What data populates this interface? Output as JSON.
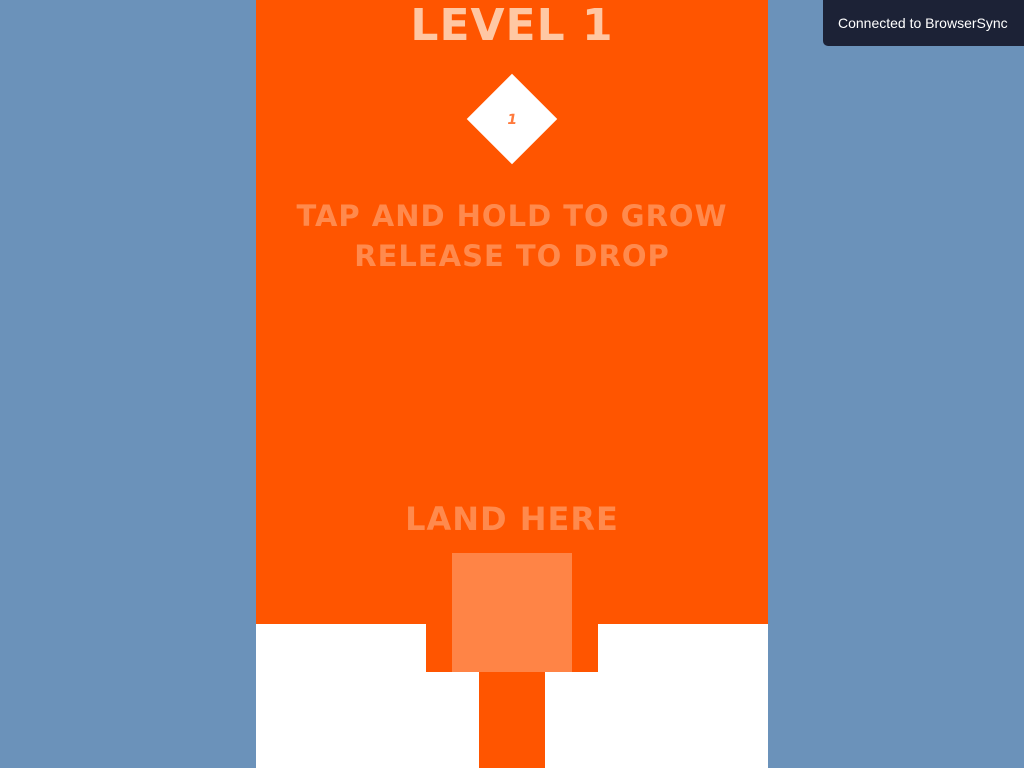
{
  "game": {
    "level_title": "LEVEL 1",
    "diamond_mark": "1",
    "instructions": {
      "line1": "TAP AND HOLD TO GROW",
      "line2": "RELEASE TO DROP"
    },
    "land_here": "LAND HERE"
  },
  "toast": {
    "text": "Connected to BrowserSync"
  },
  "colors": {
    "background": "#6b92ba",
    "game_background": "#ff5500",
    "title": "#ffc7a3",
    "hint_text": "#ff8a4d",
    "target": "#ff8446",
    "ground": "#ffffff",
    "toast_background": "#1c2236"
  }
}
